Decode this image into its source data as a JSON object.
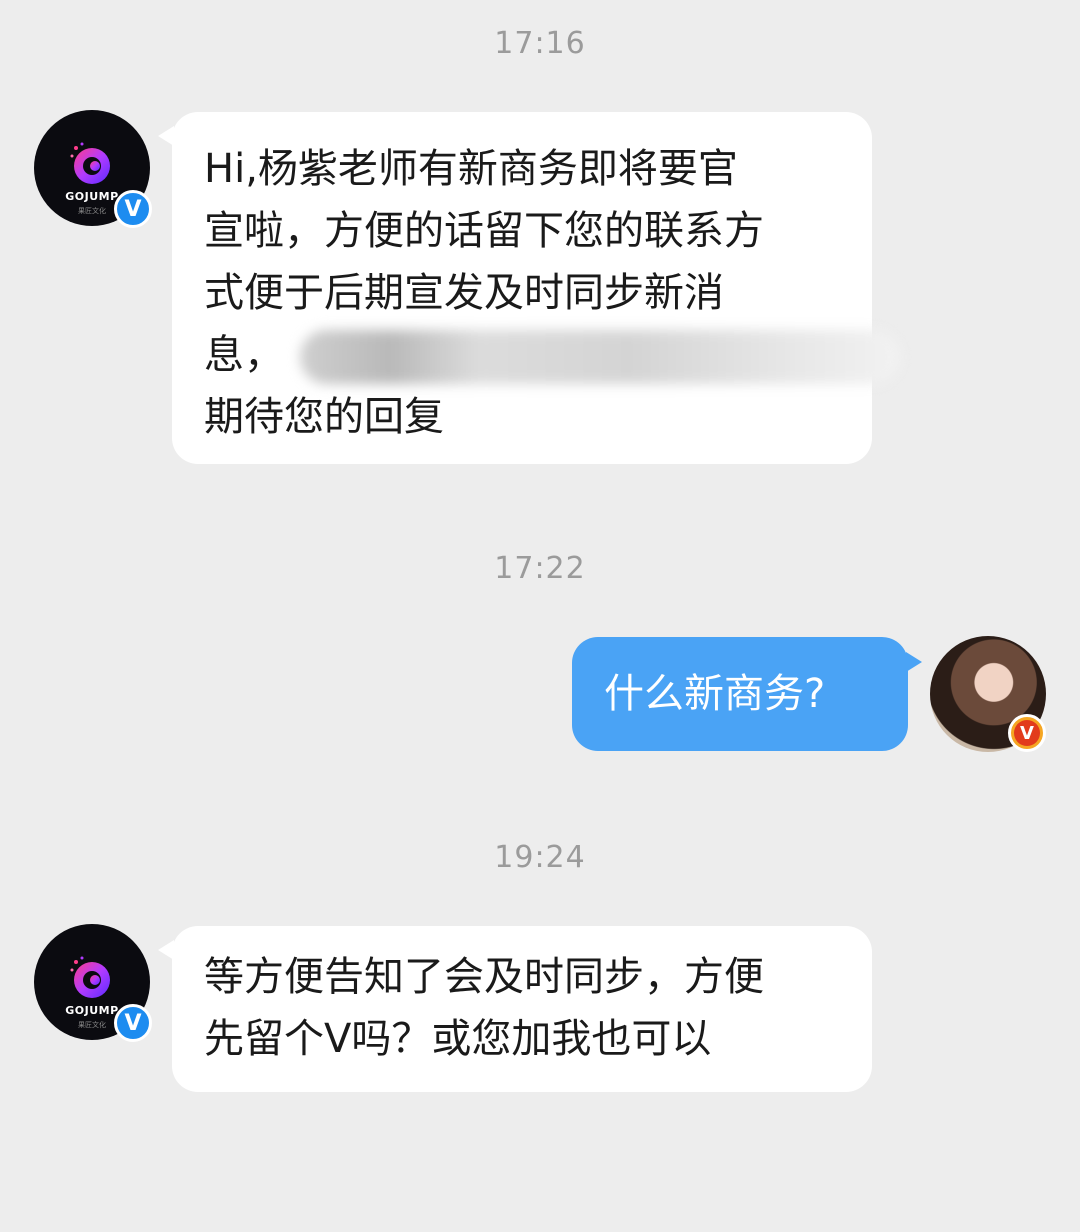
{
  "messages": [
    {
      "time": "17:16",
      "sender": "gojump",
      "lines": [
        "Hi,杨紫老师有新商务即将要官",
        "宣啦，方便的话留下您的联系方",
        "式便于后期宣发及时同步新消",
        "息，",
        "期待您的回复"
      ]
    },
    {
      "time": "17:22",
      "sender": "self",
      "text": "什么新商务?"
    },
    {
      "time": "19:24",
      "sender": "gojump",
      "lines": [
        "等方便告知了会及时同步，方便",
        "先留个V吗？或您加我也可以"
      ]
    }
  ],
  "avatars": {
    "gojump": {
      "logo_text": "GOJUMP",
      "sub_text": "果匠文化",
      "badge": "V",
      "badge_color": "#1d8cf0"
    },
    "self": {
      "badge": "V",
      "badge_color": "#f5a623"
    }
  },
  "colors": {
    "background": "#ededed",
    "left_bubble": "#ffffff",
    "right_bubble": "#4aa3f5",
    "time_text": "#9b9b9b"
  }
}
